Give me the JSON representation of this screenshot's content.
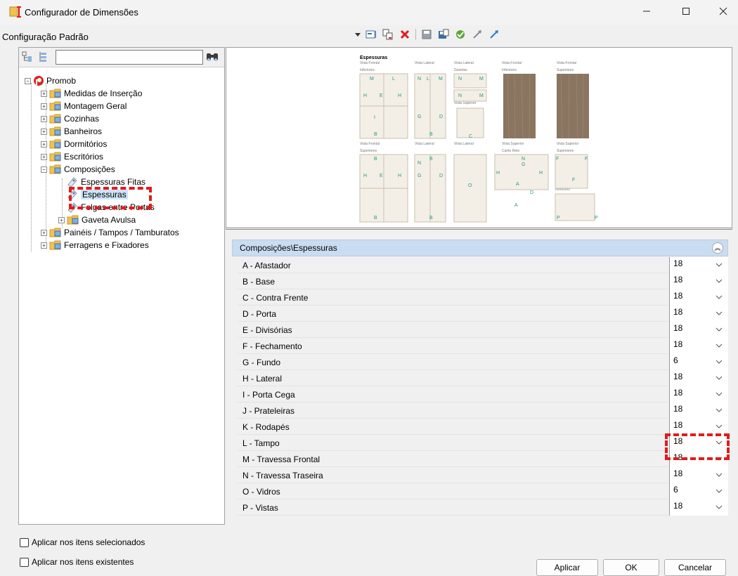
{
  "window": {
    "title": "Configurador de Dimensões"
  },
  "config_title": "Configuração Padrão",
  "toolbar": {
    "icons": [
      "dropdown-icon",
      "layout-icon",
      "copy-icon",
      "delete-icon",
      "save-icon",
      "save-as-icon",
      "validate-icon",
      "export-icon",
      "import-icon"
    ]
  },
  "tree_search": {
    "value": "",
    "placeholder": ""
  },
  "tree": {
    "root": "Promob",
    "items": [
      "Medidas de Inserção",
      "Montagem Geral",
      "Cozinhas",
      "Banheiros",
      "Dormitórios",
      "Escritórios",
      "Composições"
    ],
    "composicoes_children": [
      "Espessuras Fitas",
      "Espessuras",
      "Folgas entre Portas",
      "Gaveta Avulsa"
    ],
    "after": [
      "Painéis / Tampos / Tamburatos",
      "Ferragens e Fixadores"
    ]
  },
  "preview": {
    "heading": "Espessuras",
    "labels": [
      "Vista Frontal",
      "Vista Lateral",
      "Vista Lateral",
      "Vista Frontal",
      "Vista Frontal",
      "Inferiores",
      "Gavetas",
      "Inferiores",
      "Superiores",
      "Vista Superior",
      "Vista Frontal",
      "Vista Lateral",
      "Vista Lateral",
      "Vista Superior",
      "Vista Superior",
      "Superiores",
      "Canto Reto",
      "Superiores",
      "Inferiores"
    ]
  },
  "properties": {
    "header": "Composições\\Espessuras",
    "rows": [
      {
        "label": "A - Afastador",
        "value": "18"
      },
      {
        "label": "B - Base",
        "value": "18"
      },
      {
        "label": "C - Contra Frente",
        "value": "18"
      },
      {
        "label": "D - Porta",
        "value": "18"
      },
      {
        "label": "E - Divisórias",
        "value": "18"
      },
      {
        "label": "F - Fechamento",
        "value": "18"
      },
      {
        "label": "G - Fundo",
        "value": "6"
      },
      {
        "label": "H - Lateral",
        "value": "18"
      },
      {
        "label": "I - Porta Cega",
        "value": "18"
      },
      {
        "label": "J - Prateleiras",
        "value": "18"
      },
      {
        "label": "K - Rodapés",
        "value": "18"
      },
      {
        "label": "L - Tampo",
        "value": "18"
      },
      {
        "label": "M - Travessa Frontal",
        "value": "18"
      },
      {
        "label": "N - Travessa Traseira",
        "value": "18"
      },
      {
        "label": "O - Vidros",
        "value": "6"
      },
      {
        "label": "P - Vistas",
        "value": "18"
      }
    ]
  },
  "checkboxes": {
    "selected_items": "Aplicar nos itens selecionados",
    "existing_items": "Aplicar nos itens existentes"
  },
  "buttons": {
    "apply": "Aplicar",
    "ok": "OK",
    "cancel": "Cancelar"
  },
  "colors": {
    "highlight": "#e21b1b",
    "folder": "#f2c14e",
    "header_bg": "#c9dcf0",
    "root_icon": "#d9261c"
  }
}
